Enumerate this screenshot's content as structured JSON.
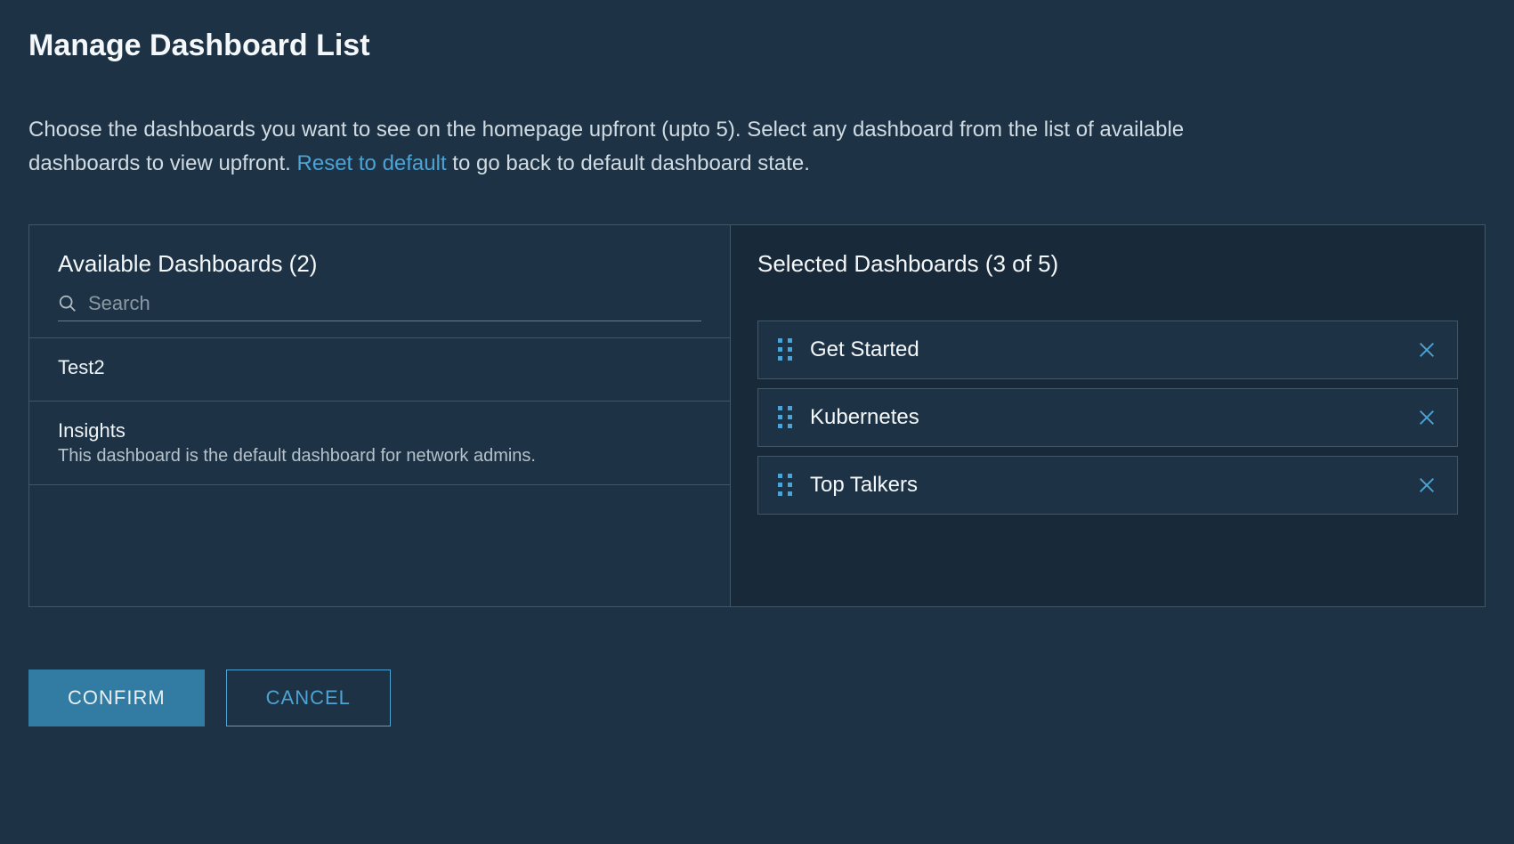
{
  "title": "Manage Dashboard List",
  "description": {
    "part1": "Choose the dashboards you want to see on the homepage upfront (upto 5). Select any dashboard from the list of available dashboards to view upfront. ",
    "reset_link": "Reset to default",
    "part2": " to go back to default dashboard state."
  },
  "available_panel": {
    "heading": "Available Dashboards (2)",
    "search_placeholder": "Search",
    "items": [
      {
        "title": "Test2",
        "description": ""
      },
      {
        "title": "Insights",
        "description": "This dashboard is the default dashboard for network admins."
      }
    ]
  },
  "selected_panel": {
    "heading": "Selected Dashboards (3 of 5)",
    "items": [
      {
        "label": "Get Started"
      },
      {
        "label": "Kubernetes"
      },
      {
        "label": "Top Talkers"
      }
    ]
  },
  "footer": {
    "confirm": "CONFIRM",
    "cancel": "CANCEL"
  }
}
